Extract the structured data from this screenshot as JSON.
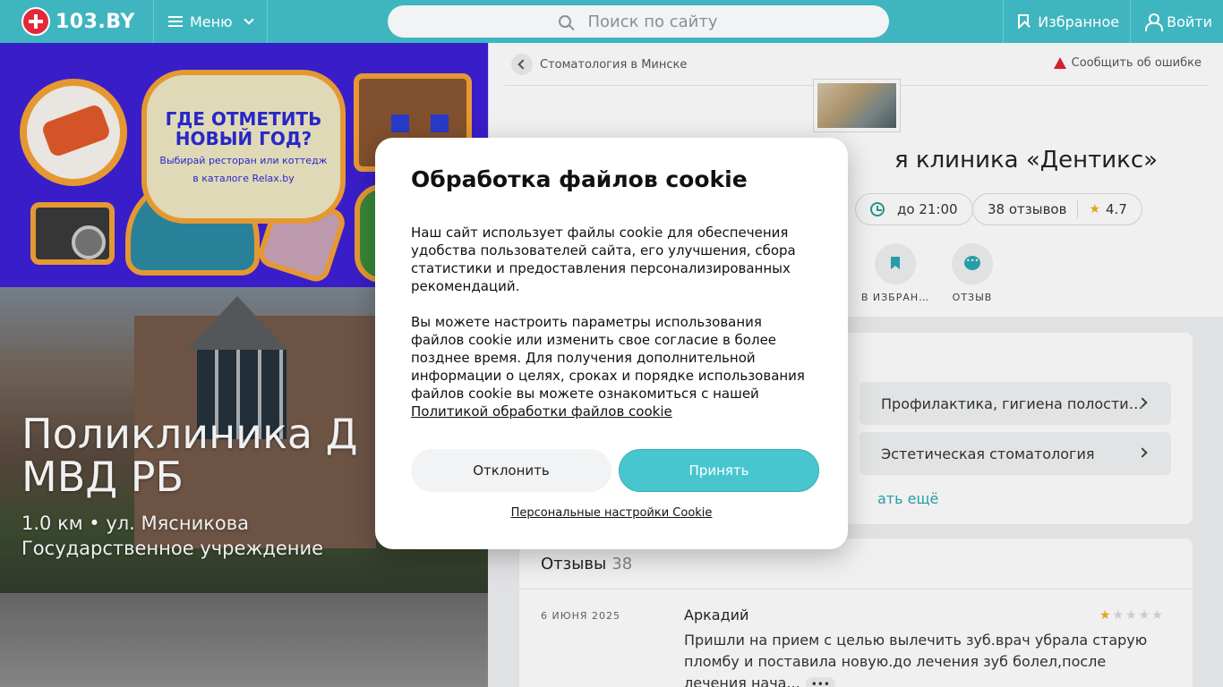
{
  "header": {
    "logo_text": "103.BY",
    "menu_label": "Меню",
    "search_placeholder": "Поиск по сайту",
    "favorites_label": "Избранное",
    "login_label": "Войти",
    "brand_color": "#3fb5bf"
  },
  "banner": {
    "title_line1": "ГДЕ ОТМЕТИТЬ",
    "title_line2": "НОВЫЙ ГОД?",
    "subtitle_line1": "Выбирай ресторан или коттедж",
    "subtitle_line2": "в каталоге Relax.by"
  },
  "hero": {
    "title_line1": "Поликлиника Д",
    "title_line2": "МВД РБ",
    "distance_address": "1.0 км • ул. Мясникова",
    "org_type": "Государственное учреждение"
  },
  "detail": {
    "breadcrumb": "Стоматология в Минске",
    "report_error": "Сообщить об ошибке",
    "clinic_title": "я клиника «Дентикс»",
    "hours": "до 21:00",
    "reviews_chip": "38 отзывов",
    "rating": "4.7",
    "actions": {
      "favorites": "В ИЗБРАН…",
      "review": "ОТЗЫВ"
    }
  },
  "services": {
    "items": [
      "Профилактика, гигиена полости…",
      "Эстетическая стоматология"
    ],
    "show_more": "ать ещё"
  },
  "reviews": {
    "heading": "Отзывы",
    "count": "38",
    "items": [
      {
        "date": "6 ИЮНЯ 2025",
        "author": "Аркадий",
        "stars": 1,
        "stars_max": 5,
        "text": "Пришли на прием с целью вылечить зуб.врач убрала старую пломбу и поставила новую.до лечения зуб болел,после лечения нача..."
      }
    ]
  },
  "cookie_modal": {
    "title": "Обработка файлов cookie",
    "paragraph1": "Наш сайт использует файлы cookie для обеспечения удобства пользователей сайта, его улучшения, сбора статистики и предоставления персонализированных рекомендаций.",
    "paragraph2": "Вы можете настроить параметры использования файлов cookie или изменить свое согласие в более позднее время. Для получения дополнительной информации о целях, сроках и порядке использования файлов cookie вы можете ознакомиться с нашей",
    "policy_link": "Политикой обработки файлов cookie",
    "decline_label": "Отклонить",
    "accept_label": "Принять",
    "settings_link": "Персональные настройки Cookie",
    "accept_color": "#47c6d0"
  }
}
